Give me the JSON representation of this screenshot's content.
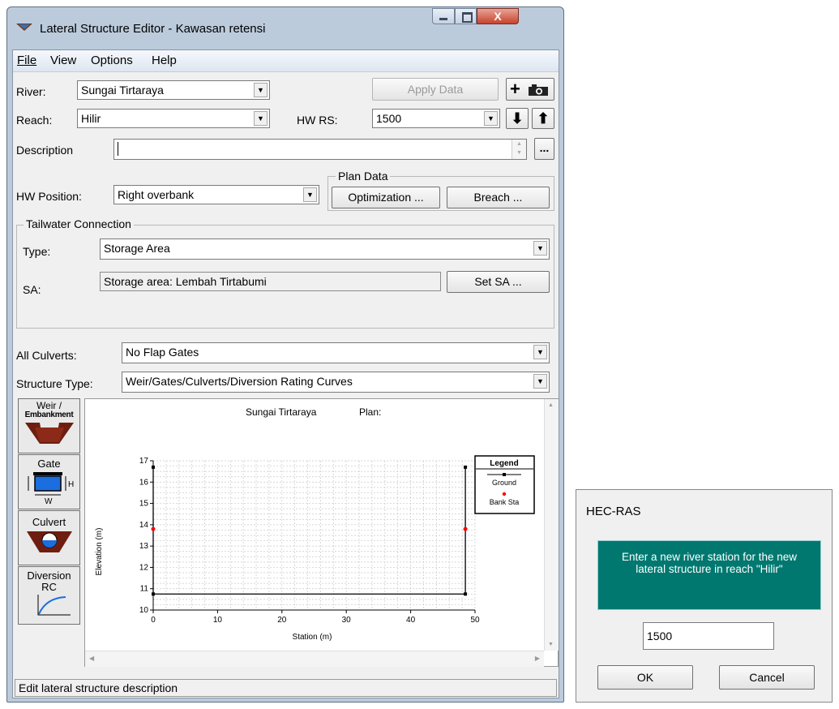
{
  "window": {
    "title": "Lateral Structure Editor - Kawasan retensi",
    "minimize_label": "",
    "maximize_label": "",
    "close_label": "X"
  },
  "menu": [
    "File",
    "View",
    "Options",
    "Help"
  ],
  "form": {
    "river_label": "River:",
    "river_value": "Sungai Tirtaraya",
    "apply_data": "Apply Data",
    "reach_label": "Reach:",
    "reach_value": "Hilir",
    "hw_rs_label": "HW RS:",
    "hw_rs_value": "1500",
    "description_label": "Description",
    "description_value": "",
    "ellipsis": "...",
    "hw_position_label": "HW Position:",
    "hw_position_value": "Right overbank",
    "plan_data_title": "Plan Data",
    "optimization_btn": "Optimization ...",
    "breach_btn": "Breach ...",
    "tailwater_title": "Tailwater Connection",
    "type_label": "Type:",
    "type_value": "Storage Area",
    "sa_label": "SA:",
    "sa_value": "Storage area: Lembah Tirtabumi",
    "set_sa_btn": "Set SA ...",
    "all_culverts_label": "All Culverts:",
    "all_culverts_value": "No Flap Gates",
    "structure_type_label": "Structure Type:",
    "structure_type_value": "Weir/Gates/Culverts/Diversion Rating Curves"
  },
  "side_buttons": {
    "weir": [
      "Weir /",
      "Embankment"
    ],
    "gate": [
      "Gate"
    ],
    "culvert": [
      "Culvert"
    ],
    "diversion": [
      "Diversion",
      "RC"
    ],
    "gate_h": "H",
    "gate_w": "W"
  },
  "status_bar": "Edit lateral structure description",
  "chart_data": {
    "type": "line",
    "title": "Sungai Tirtaraya",
    "plan_label": "Plan:",
    "xlabel": "Station (m)",
    "ylabel": "Elevation (m)",
    "xlim": [
      0,
      50
    ],
    "ylim": [
      10,
      17
    ],
    "x_ticks": [
      0,
      10,
      20,
      30,
      40,
      50
    ],
    "y_ticks": [
      10,
      11,
      12,
      13,
      14,
      15,
      16,
      17
    ],
    "grid": true,
    "legend_title": "Legend",
    "legend_placement": "top-right",
    "series": [
      {
        "name": "Ground",
        "color": "#000000",
        "points": [
          [
            0,
            16.7
          ],
          [
            0,
            10.75
          ],
          [
            48.5,
            10.75
          ],
          [
            48.5,
            16.7
          ]
        ]
      },
      {
        "name": "Bank Sta",
        "color": "#ff0000",
        "points": [
          [
            0,
            13.8
          ],
          [
            48.5,
            13.8
          ]
        ]
      }
    ]
  },
  "dialog": {
    "title": "HEC-RAS",
    "message_line1": "Enter a new river station for the new",
    "message_line2": "lateral structure in reach \"Hilir\"",
    "input_value": "1500",
    "ok": "OK",
    "cancel": "Cancel",
    "message_bg": "#007870"
  }
}
